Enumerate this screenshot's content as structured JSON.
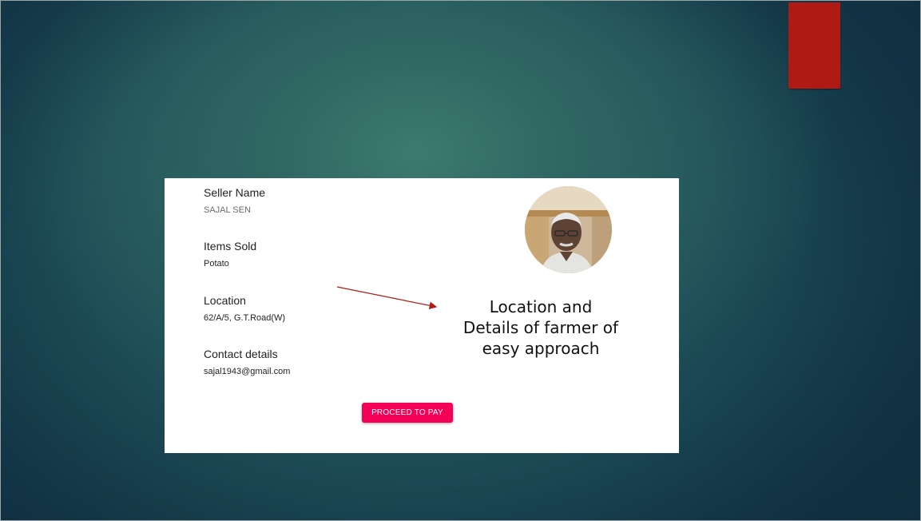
{
  "card": {
    "fields": [
      {
        "label": "Seller Name",
        "value": "SAJAL SEN"
      },
      {
        "label": "Items Sold",
        "value": "Potato"
      },
      {
        "label": "Location",
        "value": "62/A/5, G.T.Road(W)"
      },
      {
        "label": "Contact details",
        "value": "sajal1943@gmail.com"
      }
    ],
    "button_label": "PROCEED TO PAY",
    "avatar_icon": "seller-photo"
  },
  "annotation": {
    "lines": [
      "Location and",
      "Details of farmer of",
      "easy approach"
    ]
  },
  "colors": {
    "accent_bar": "#b01a14",
    "button": "#f50057",
    "arrow": "#b01a14",
    "background": "#1f4f55"
  }
}
